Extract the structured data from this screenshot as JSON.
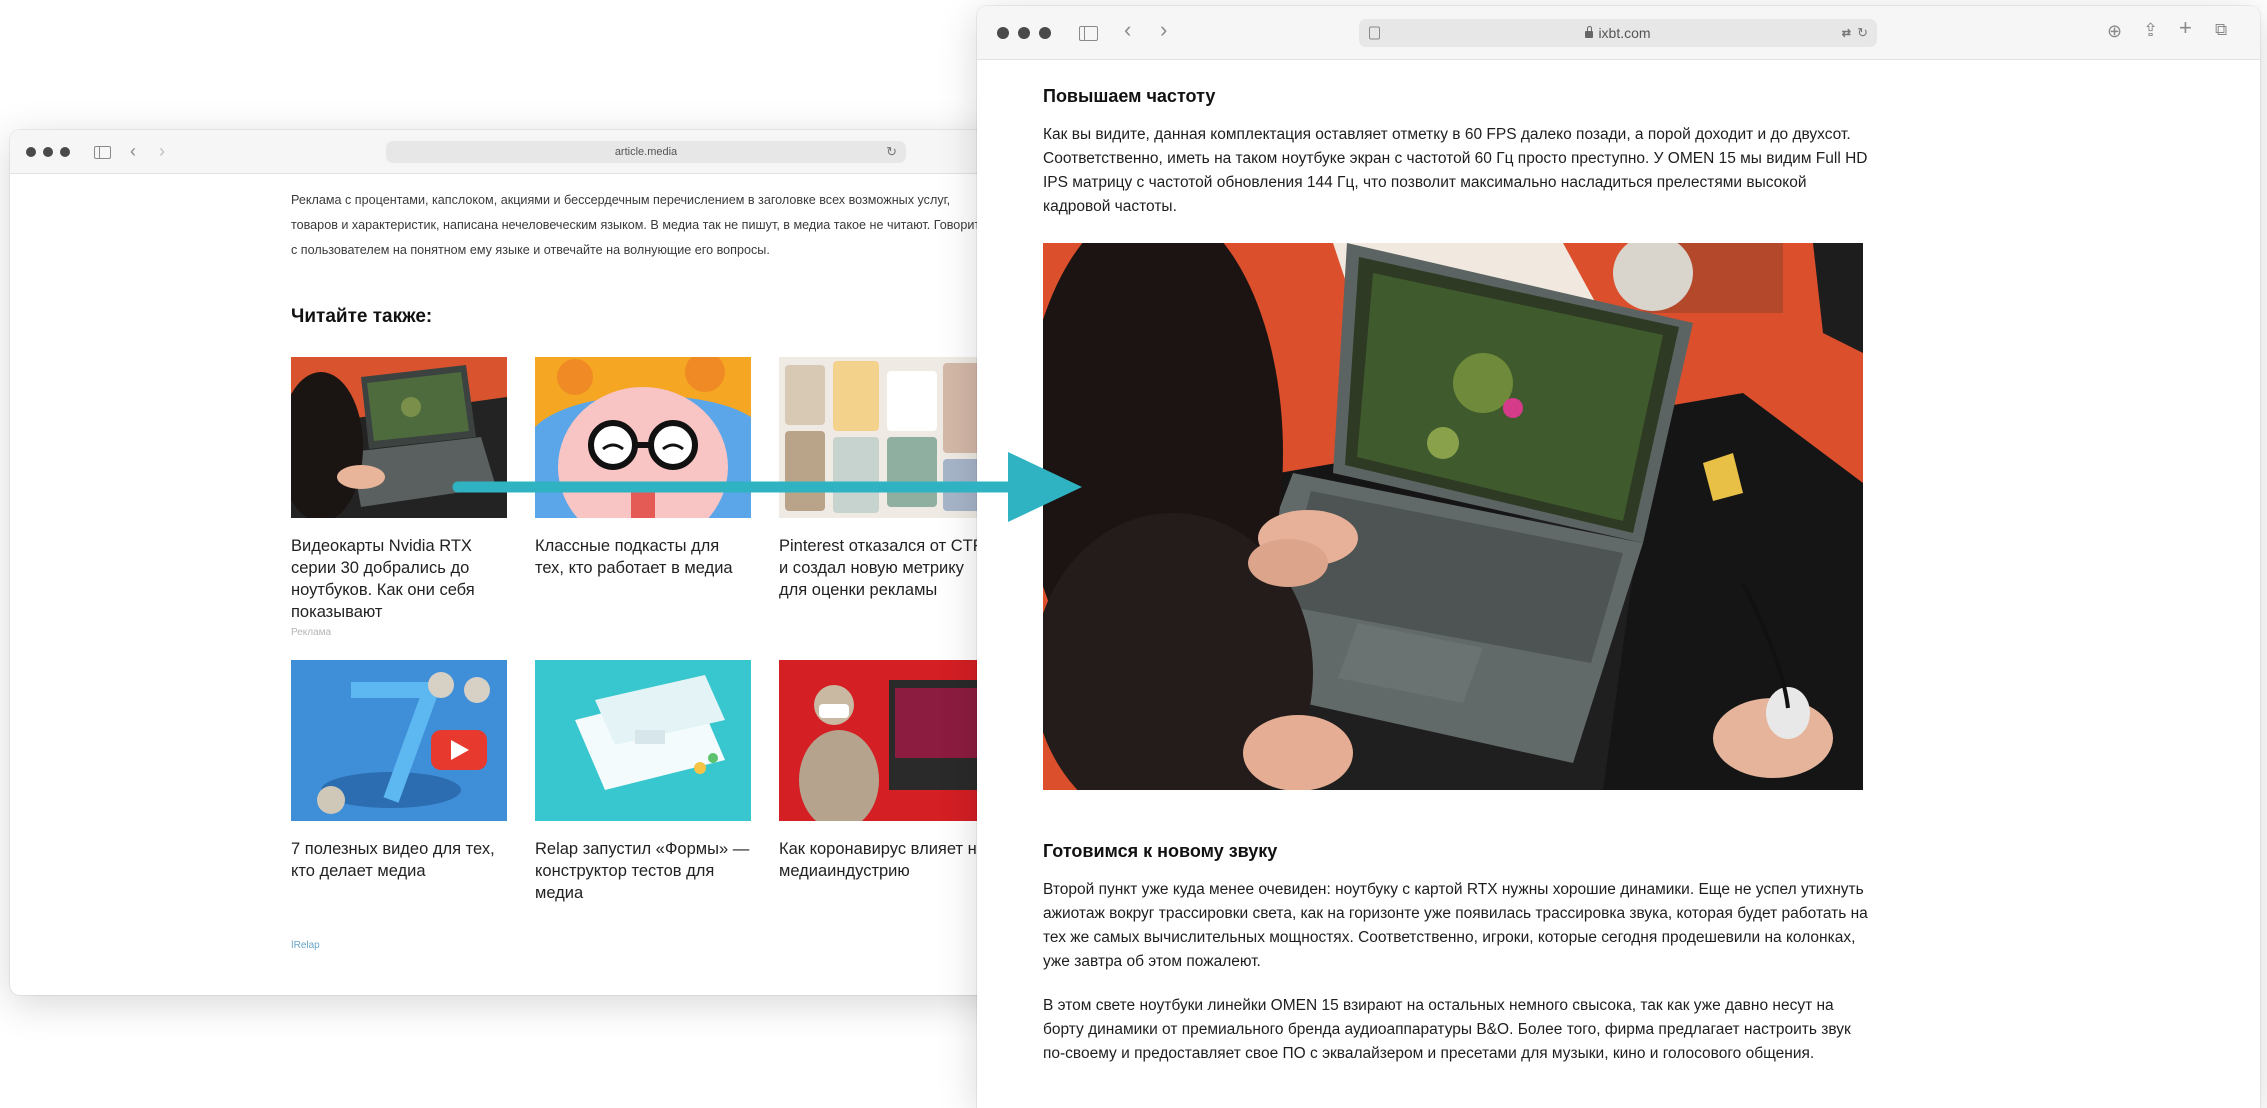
{
  "left_window": {
    "url": "article.media",
    "intro": "Реклама с процентами, капслоком, акциями и бессердечным перечислением в заголовке всех возможных услуг, товаров и характеристик, написана нечеловеческим языком. В медиа так не пишут, в медиа такое не читают. Говорите с пользователем на понятном ему языке и отвечайте на волнующие его вопросы.",
    "read_also_title": "Читайте также:",
    "cards": [
      {
        "title": "Видеокарты Nvidia RTX серии 30 добрались до ноутбуков. Как они себя показывают",
        "badge": "Реклама"
      },
      {
        "title": "Классные подкасты для тех, кто работает в медиа"
      },
      {
        "title": "Pinterest отказался от CTR и создал новую метрику для оценки рекламы"
      },
      {
        "title": "7 полезных видео для тех, кто делает медиа"
      },
      {
        "title": "Relap запустил «Формы» — конструктор тестов для медиа"
      },
      {
        "title": "Как коронавирус влияет на медиаиндустрию"
      }
    ],
    "footer_brand": "Relap"
  },
  "right_window": {
    "url": "ixbt.com",
    "heading1": "Повышаем частоту",
    "para1": "Как вы видите, данная комплектация оставляет отметку в 60 FPS далеко позади, а порой доходит и до двухсот. Соответственно, иметь на таком ноутбуке экран с частотой 60 Гц просто преступно. У OMEN 15 мы видим Full HD IPS матрицу с частотой обновления 144 Гц, что позволит максимально насладиться прелестями высокой кадровой частоты.",
    "heading2": "Готовимся к новому звуку",
    "para2": "Второй пункт уже куда менее очевиден: ноутбуку с картой RTX нужны хорошие динамики. Еще не успел утихнуть ажиотаж вокруг трассировки света, как на горизонте уже появилась трассировка звука, которая будет работать на тех же самых вычислительных мощностях. Соответственно, игроки, которые сегодня продешевили на колонках, уже завтра об этом пожалеют.",
    "para3": "В этом свете ноутбуки линейки OMEN 15 взирают на остальных немного свысока, так как уже давно несут на борту динамики от премиального бренда аудиоаппаратуры B&O. Более того, фирма предлагает настроить звук по-своему и предоставляет свое ПО с эквалайзером и пресетами для музыки, кино и голосового общения."
  },
  "icons": {
    "back": "chevron-left-icon",
    "forward": "chevron-right-icon",
    "reload": "reload-icon",
    "sidebar": "sidebar-icon",
    "download": "download-icon",
    "share": "share-icon",
    "new_tab": "plus-icon",
    "tabs": "tabs-overview-icon",
    "lock": "lock-icon"
  },
  "colors": {
    "arrow": "#2fb3c2",
    "desk_orange": "#e0502c",
    "laptop_gray": "#5c6463"
  }
}
